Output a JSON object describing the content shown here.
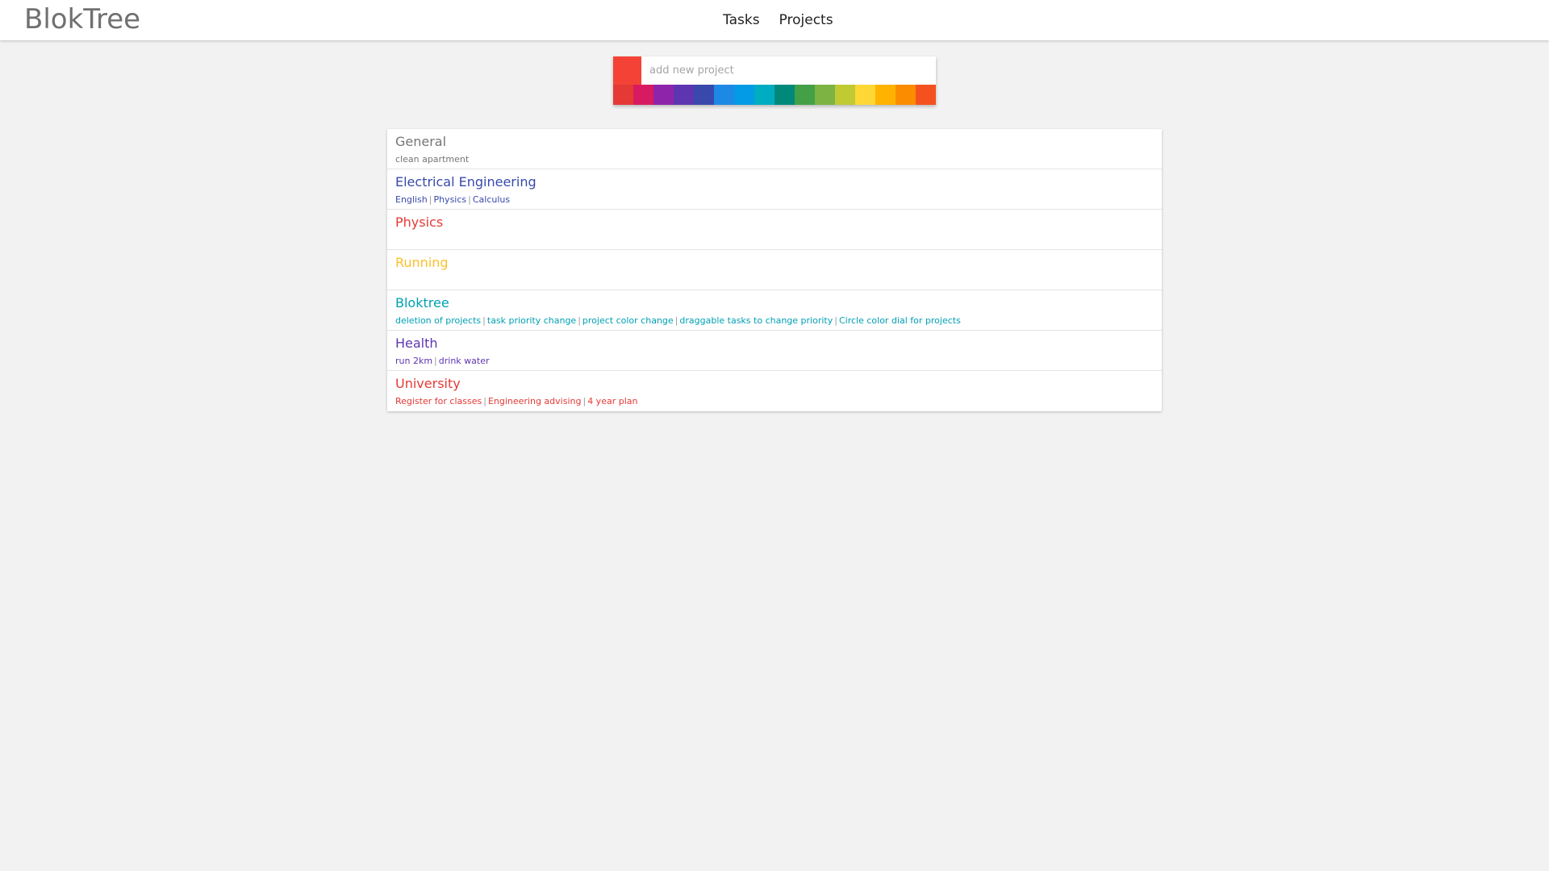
{
  "app": {
    "title": "BlokTree"
  },
  "nav": {
    "tasks_label": "Tasks",
    "projects_label": "Projects"
  },
  "add_project": {
    "placeholder": "add new project",
    "selected_color": "#f44336",
    "palette": [
      "#e53935",
      "#d81b60",
      "#8e24aa",
      "#5e35b1",
      "#3949ab",
      "#1e88e5",
      "#039be5",
      "#00acc1",
      "#00897b",
      "#43a047",
      "#7cb342",
      "#c0ca33",
      "#fdd835",
      "#ffb300",
      "#fb8c00",
      "#f4511e"
    ]
  },
  "projects": [
    {
      "name": "General",
      "color": "#757575",
      "tasks": [
        "clean apartment"
      ]
    },
    {
      "name": "Electrical Engineering",
      "color": "#3949ab",
      "tasks": [
        "English",
        "Physics",
        "Calculus"
      ]
    },
    {
      "name": "Physics",
      "color": "#e53935",
      "tasks": []
    },
    {
      "name": "Running",
      "color": "#fbc02d",
      "tasks": []
    },
    {
      "name": "Bloktree",
      "color": "#00a0b4",
      "tasks": [
        "deletion of projects",
        "task priority change",
        "project color change",
        "draggable tasks to change priority",
        "Circle color dial for projects"
      ]
    },
    {
      "name": "Health",
      "color": "#5e35b1",
      "tasks": [
        "run 2km",
        "drink water"
      ]
    },
    {
      "name": "University",
      "color": "#e53935",
      "tasks": [
        "Register for classes",
        "Engineering advising ",
        "4 year plan"
      ]
    }
  ]
}
